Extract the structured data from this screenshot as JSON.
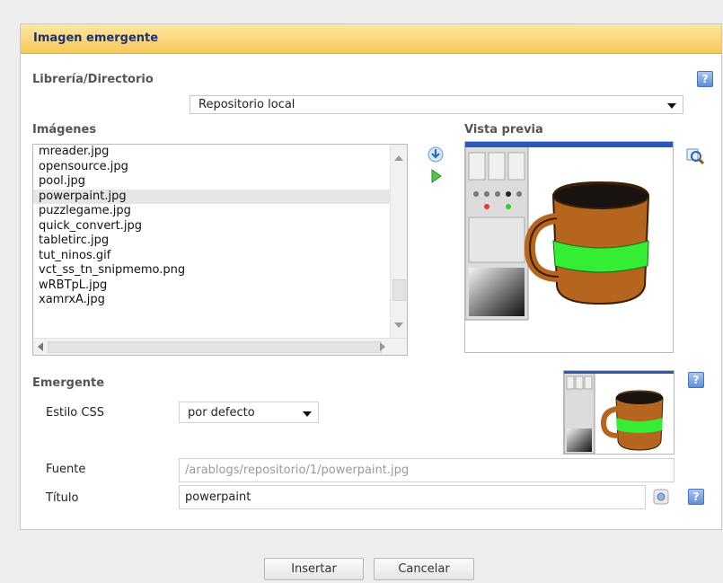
{
  "dialog": {
    "title": "Imagen emergente"
  },
  "library": {
    "label": "Librería/Directorio",
    "selected": "Repositorio local"
  },
  "images": {
    "label": "Imágenes",
    "items": [
      "mreader.jpg",
      "opensource.jpg",
      "pool.jpg",
      "powerpaint.jpg",
      "puzzlegame.jpg",
      "quick_convert.jpg",
      "tabletirc.jpg",
      "tut_ninos.gif",
      "vct_ss_tn_snipmemo.png",
      "wRBTpL.jpg",
      "xamrxA.jpg"
    ],
    "selected_index": 3
  },
  "preview": {
    "label": "Vista previa"
  },
  "emergente": {
    "label": "Emergente",
    "css_label": "Estilo CSS",
    "css_selected": "por defecto"
  },
  "fuente": {
    "label": "Fuente",
    "value": "/arablogs/repositorio/1/powerpaint.jpg"
  },
  "titulo": {
    "label": "Título",
    "value": "powerpaint"
  },
  "buttons": {
    "insert": "Insertar",
    "cancel": "Cancelar"
  },
  "help": {
    "glyph": "?"
  },
  "colors": {
    "titlebar": "#f9c85a",
    "title_text": "#1e3470",
    "help_blue": "#5f8fd4",
    "mug_brown": "#b5651d",
    "mug_band": "#33ee33"
  }
}
